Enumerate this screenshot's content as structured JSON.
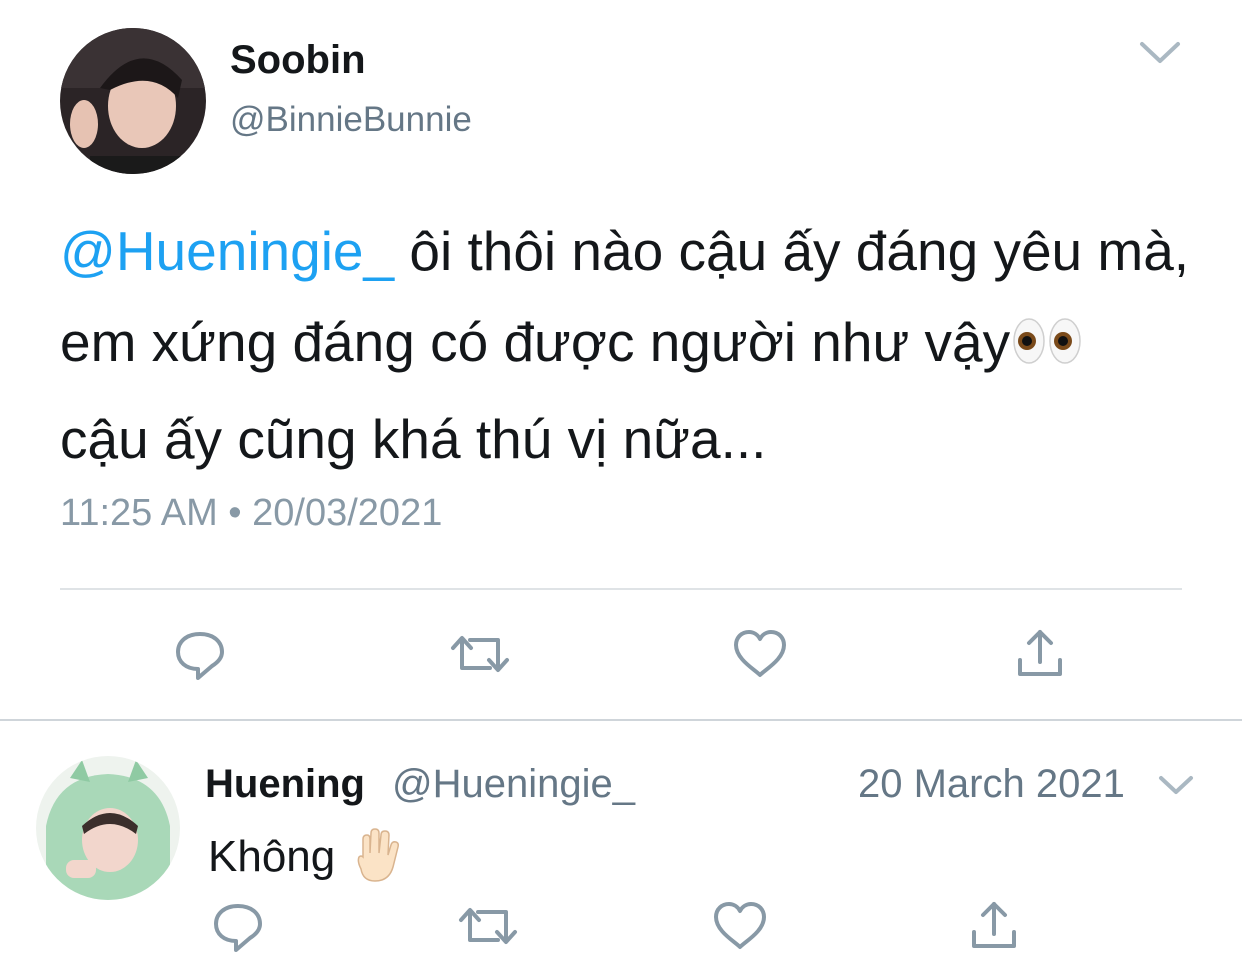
{
  "tweet": {
    "author_name": "Soobin",
    "author_handle": "@BinnieBunnie",
    "mention": "@Hueningie_",
    "text_part1": " ôi thôi nào cậu ấy đáng yêu mà, em xứng đáng có được người như vậy",
    "emoji": "eyes-emoji",
    "text_part2": " cậu ấy cũng khá thú vị nữa...",
    "timestamp": "11:25 AM • 20/03/2021"
  },
  "reply": {
    "author_name": "Huening",
    "author_handle": "@Hueningie_",
    "date": "20 March 2021",
    "text": "Không",
    "emoji": "raised-hand-emoji"
  },
  "colors": {
    "mention_blue": "#1da1f2",
    "secondary_gray": "#657786",
    "icon_gray": "#8899a6"
  },
  "icons": [
    "chevron-down-icon",
    "reply-icon",
    "retweet-icon",
    "like-icon",
    "share-icon"
  ]
}
